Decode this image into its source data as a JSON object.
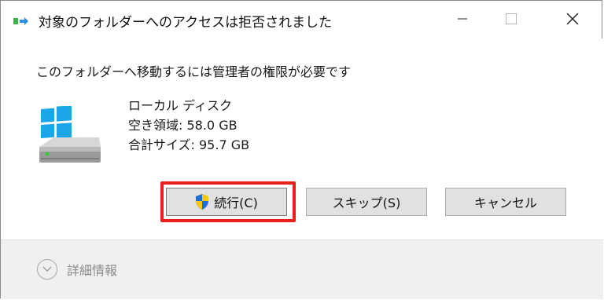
{
  "window": {
    "title": "対象のフォルダーへのアクセスは拒否されました",
    "app_icon": "folder-move-icon",
    "controls": [
      "minimize-icon",
      "maximize-icon",
      "close-icon"
    ]
  },
  "message": "このフォルダーへ移動するには管理者の権限が必要です",
  "drive": {
    "icon": "windows-drive-icon",
    "name": "ローカル ディスク",
    "free_space": "空き領域: 58.0 GB",
    "total_size": "合計サイズ: 95.7 GB"
  },
  "buttons": {
    "continue": {
      "label": "続行(C)",
      "icon": "uac-shield-icon"
    },
    "skip": {
      "label": "スキップ(S)"
    },
    "cancel": {
      "label": "キャンセル"
    }
  },
  "footer": {
    "details_label": "詳細情報",
    "details_icon": "chevron-down-icon"
  },
  "colors": {
    "highlight": "#e8201c",
    "windows_logo": "#1aa6e8",
    "drive_led": "#3cc23c",
    "footer_bg": "#f0f0f0"
  }
}
